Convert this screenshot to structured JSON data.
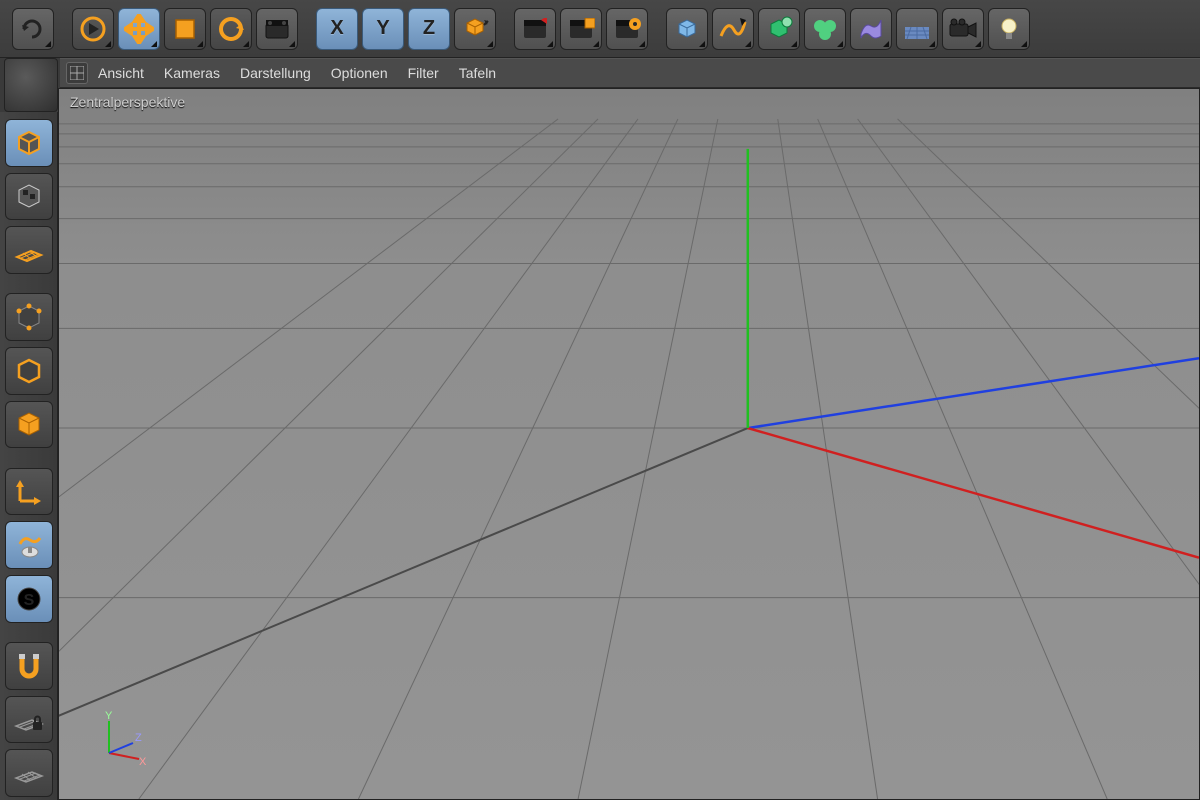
{
  "viewport": {
    "title": "Zentralperspektive",
    "menu": [
      "Ansicht",
      "Kameras",
      "Darstellung",
      "Optionen",
      "Filter",
      "Tafeln"
    ],
    "mini_axis": {
      "x": "X",
      "y": "Y",
      "z": "Z"
    }
  },
  "top_toolbar": {
    "axis_x": "X",
    "axis_y": "Y",
    "axis_z": "Z"
  },
  "colors": {
    "axis_x": "#d02020",
    "axis_y": "#20c020",
    "axis_z": "#2040e0",
    "accent_orange": "#f5a020",
    "accent_blue": "#7aa8d8"
  }
}
